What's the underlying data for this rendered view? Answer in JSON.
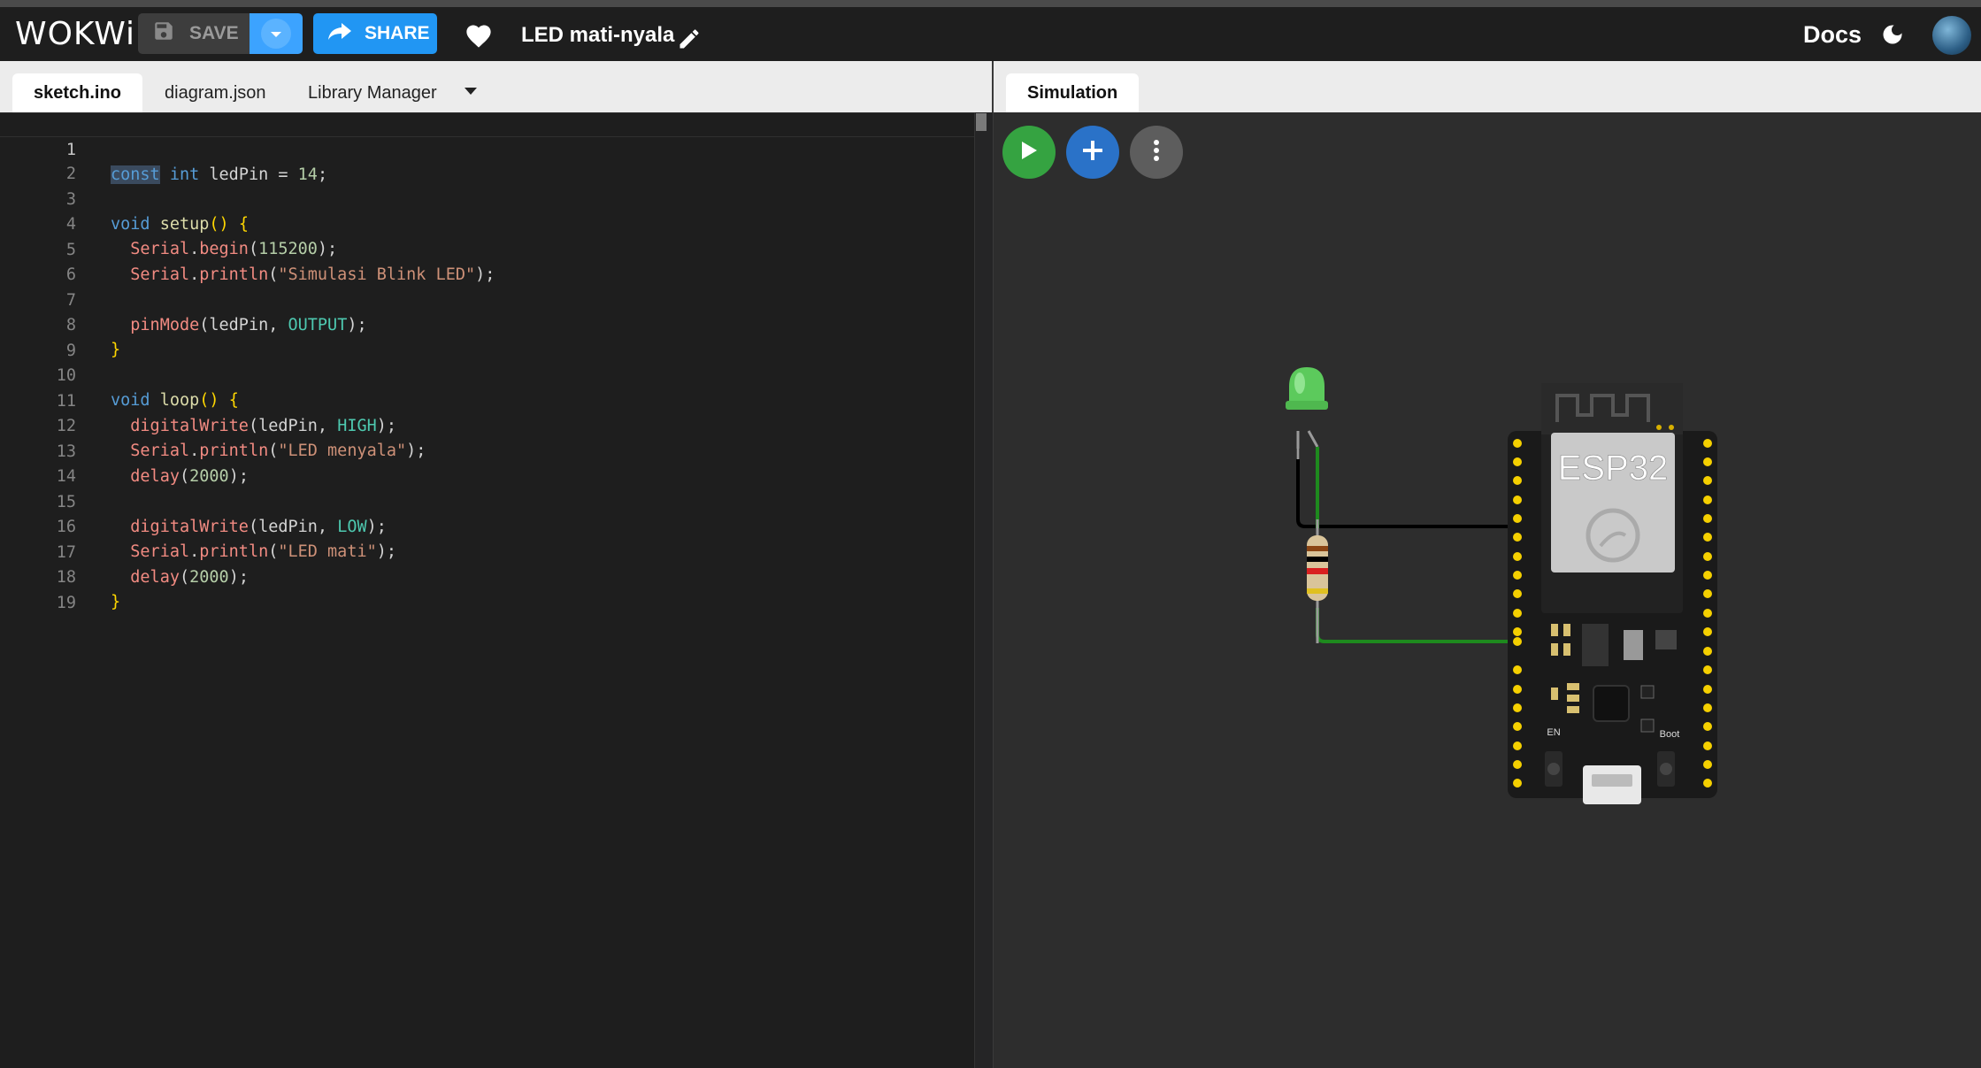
{
  "header": {
    "logo": "WOKWi",
    "save_label": "SAVE",
    "share_label": "SHARE",
    "project_title": "LED mati-nyala",
    "docs_label": "Docs"
  },
  "editor_tabs": {
    "tabs": [
      {
        "label": "sketch.ino",
        "active": true
      },
      {
        "label": "diagram.json",
        "active": false
      },
      {
        "label": "Library Manager",
        "active": false
      }
    ]
  },
  "simulation_tabs": {
    "tabs": [
      {
        "label": "Simulation",
        "active": true
      }
    ]
  },
  "code": {
    "line_numbers": [
      "1",
      "2",
      "3",
      "4",
      "5",
      "6",
      "7",
      "8",
      "9",
      "10",
      "11",
      "12",
      "13",
      "14",
      "15",
      "16",
      "17",
      "18",
      "19"
    ],
    "current_line": 1,
    "lines": [
      "const int ledPin = 14;",
      "",
      "void setup() {",
      "  Serial.begin(115200);",
      "  Serial.println(\"Simulasi Blink LED\");",
      "",
      "  pinMode(ledPin, OUTPUT);",
      "}",
      "",
      "void loop() {",
      "  digitalWrite(ledPin, HIGH);",
      "  Serial.println(\"LED menyala\");",
      "  delay(2000);",
      "",
      "  digitalWrite(ledPin, LOW);",
      "  Serial.println(\"LED mati\");",
      "  delay(2000);",
      "}",
      ""
    ]
  },
  "simulation": {
    "board_label": "ESP32",
    "boot_label": "Boot",
    "en_label": "EN"
  },
  "colors": {
    "share": "#2196f3",
    "save_dropdown": "#3ca3ff",
    "play": "#35a341",
    "add": "#2a72c8",
    "led": "#5fd35f",
    "wire_green": "#1e8a1e",
    "wire_black": "#000000"
  },
  "icons": [
    "save-icon",
    "chevron-down-icon",
    "share-icon",
    "heart-icon",
    "pencil-icon",
    "moon-icon",
    "play-icon",
    "plus-icon",
    "more-vertical-icon"
  ]
}
